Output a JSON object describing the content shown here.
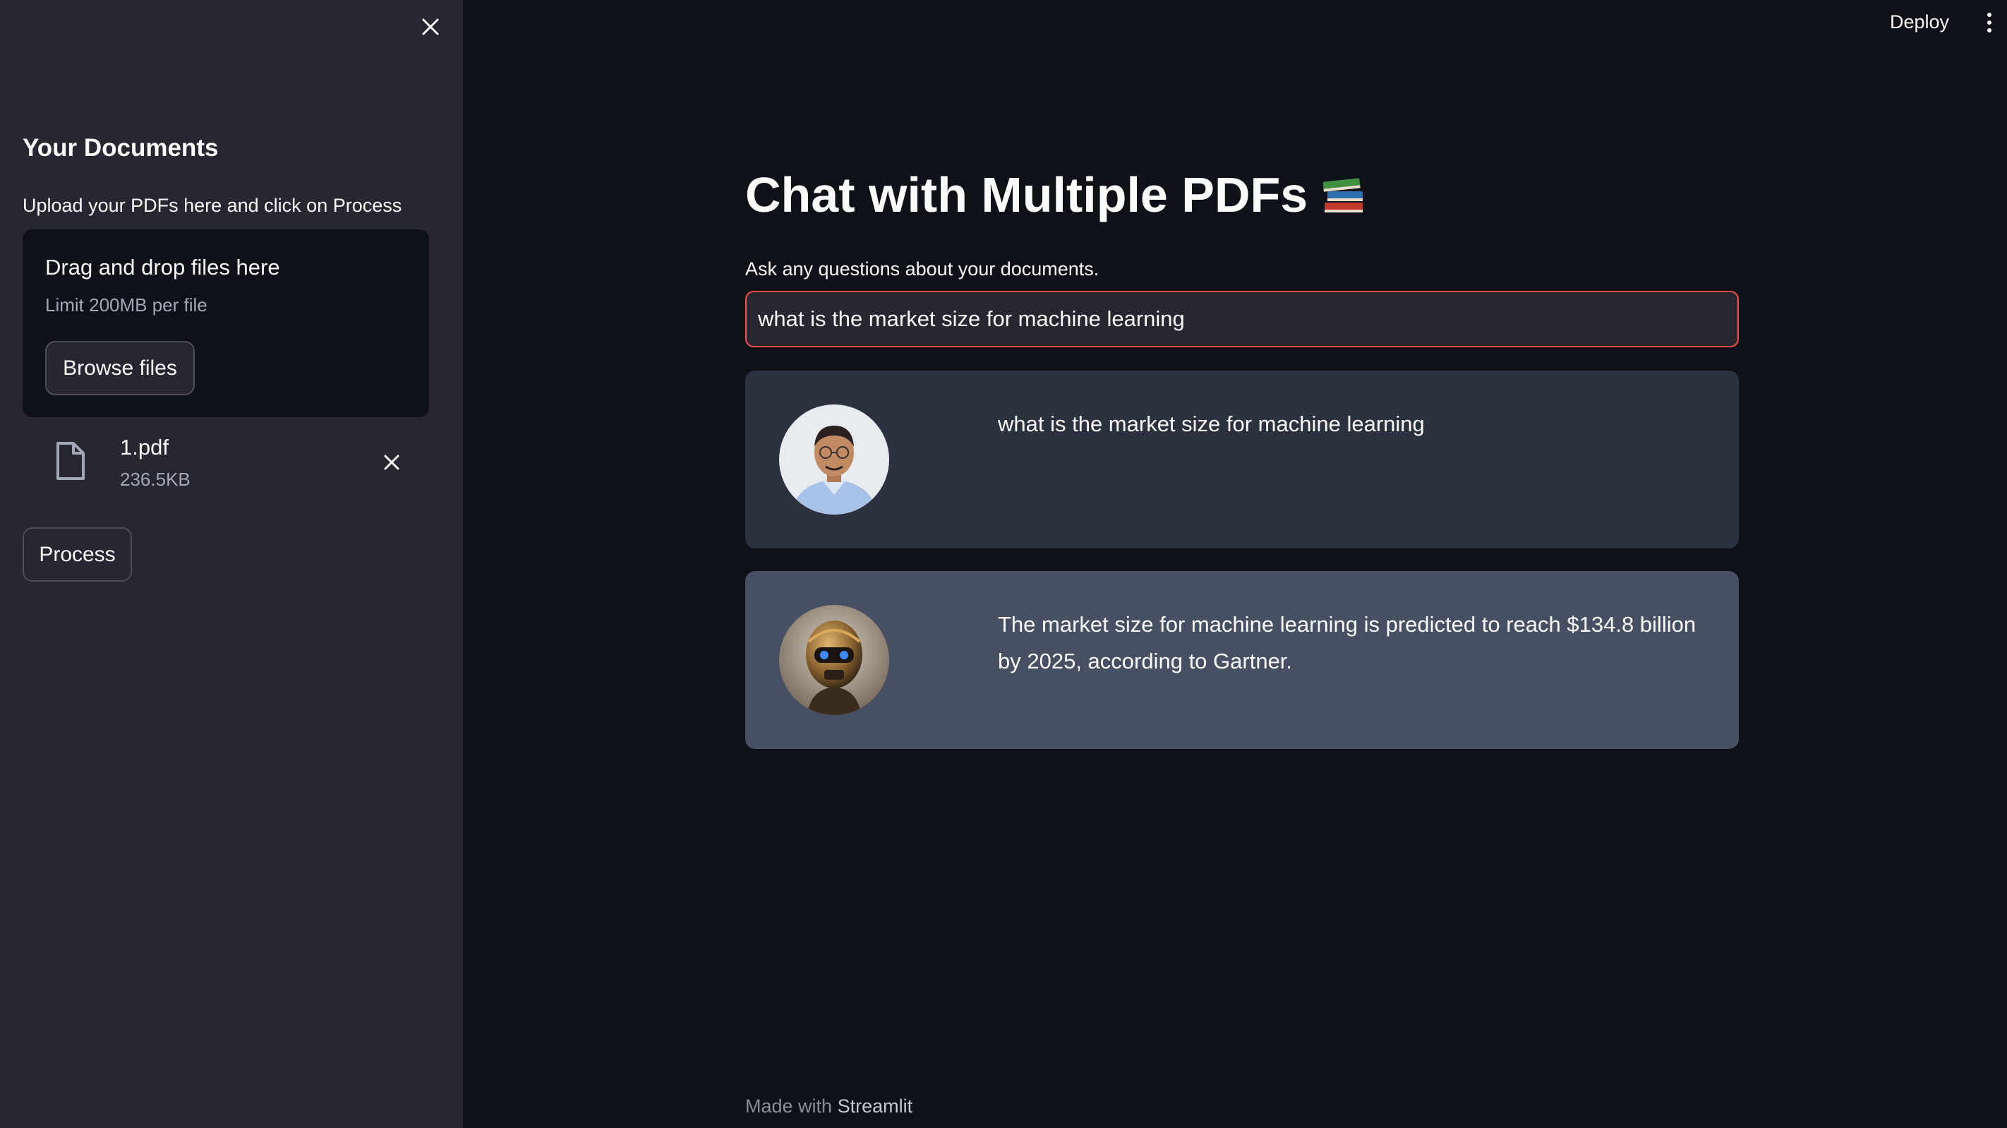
{
  "sidebar": {
    "title": "Your Documents",
    "instructions": "Upload your PDFs here and click on Process",
    "uploader": {
      "dropzone_title": "Drag and drop files here",
      "limit_text": "Limit 200MB per file",
      "browse_label": "Browse files"
    },
    "files": [
      {
        "name": "1.pdf",
        "size": "236.5KB"
      }
    ],
    "process_label": "Process"
  },
  "header": {
    "deploy_label": "Deploy"
  },
  "main": {
    "title": "Chat with Multiple PDFs",
    "title_icon": "books-emoji",
    "question_label": "Ask any questions about your documents.",
    "question_value": "what is the market size for machine learning",
    "messages": [
      {
        "role": "user",
        "avatar": "user-photo-avatar",
        "text": "what is the market size for machine learning"
      },
      {
        "role": "bot",
        "avatar": "robot-avatar",
        "text": "The market size for machine learning is predicted to reach $134.8 billion by 2025, according to Gartner."
      }
    ]
  },
  "footer": {
    "made_with": "Made with",
    "brand": "Streamlit"
  },
  "colors": {
    "app_bg": "#0e1117",
    "sidebar_bg": "#262730",
    "accent": "#ff4b4b",
    "user_msg_bg": "#2b313e",
    "bot_msg_bg": "#475063"
  }
}
